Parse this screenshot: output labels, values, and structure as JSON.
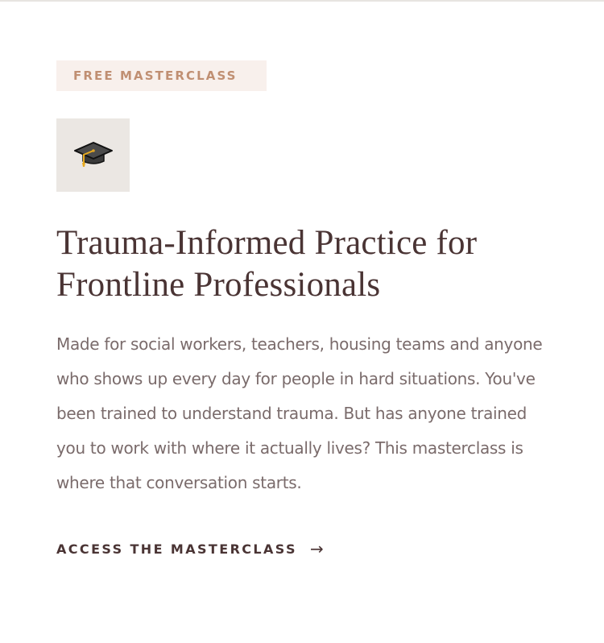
{
  "badge": {
    "label": "FREE MASTERCLASS",
    "text_color": "#c08f72",
    "background": "#f8f0ec"
  },
  "icon": {
    "name": "graduation-cap-icon",
    "background": "#ebe7e3"
  },
  "title": "Trauma-Informed Practice for Frontline Professionals",
  "description": "Made for social workers, teachers, housing teams and anyone who shows up every day for people in hard situations. You've been trained to understand trauma. But has anyone trained you to work with where it actually lives? This masterclass is where that conversation starts.",
  "cta": {
    "label": "ACCESS THE MASTERCLASS",
    "arrow": "→",
    "color": "#4a3434"
  }
}
